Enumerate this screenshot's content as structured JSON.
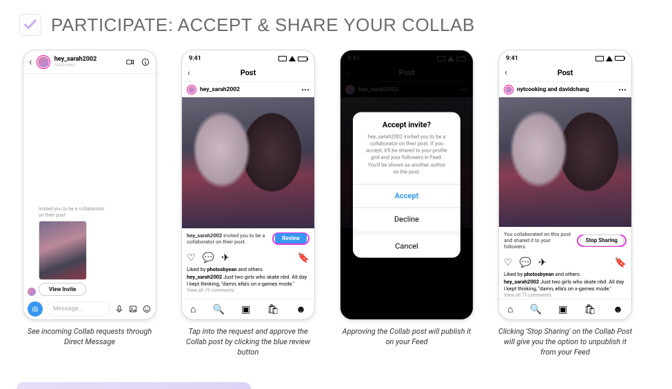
{
  "header": {
    "title": "PARTICIPATE: ACCEPT & SHARE YOUR COLLAB"
  },
  "common": {
    "time": "9:41",
    "post_title": "Post"
  },
  "phone1": {
    "username": "hey_sarah2002",
    "subtitle": "Sarah Hello",
    "invite_text": "Invited you to be a collaborator on their post",
    "view_invite": "View Invite",
    "message_placeholder": "Message..."
  },
  "phone2": {
    "username": "hey_sarah2002",
    "banner_user": "hey_sarah2002",
    "banner_rest": " invited you to be a collaborator on their post.",
    "review": "Review",
    "liked_by_prefix": "Liked by ",
    "liked_by_user": "photosbyean",
    "liked_by_suffix": " and others",
    "cap_user": "hey_sarah2002",
    "cap_text": " Just two girls who skate nbd. All day I kept thinking, \"damn, ella's on x-games mode.\"",
    "view_comments": "View all 75 comments"
  },
  "phone3": {
    "username": "hey_sarah2002",
    "modal_title": "Accept invite?",
    "modal_body": "hey_sarah2002 invited you to be a collaborator on their post. If you accept, it'll be shared to your profile grid and your followers in Feed. You'll be shown as another author on the post.",
    "accept": "Accept",
    "decline": "Decline",
    "cancel": "Cancel"
  },
  "phone4": {
    "username": "nytcooking and davidchang",
    "banner_text": "You collaborated on this post and shared it to your followers.",
    "stop_sharing": "Stop Sharing",
    "liked_by_prefix": "Liked by ",
    "liked_by_user": "photosbyean",
    "liked_by_suffix": " and others",
    "cap_user": "hey_sarah2002",
    "cap_text": " Just two girls who skate nbd. All day I kept thinking, \"damn, ella's on x-games mode.\"",
    "view_comments": "View all 75 comments"
  },
  "captions": {
    "c1": "See incoming Collab requests through Direct Message",
    "c2": "Tap into the request and approve the Collab post by clicking the blue review button",
    "c3": "Approving the Collab post will publish it on your Feed",
    "c4": "Clicking 'Stop Sharing' on the Collab Post will give you the option to unpublish it from your Feed"
  }
}
